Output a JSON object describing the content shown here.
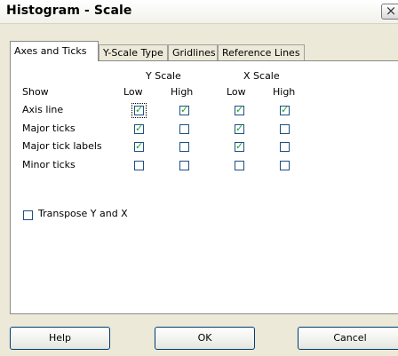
{
  "window": {
    "title": "Histogram - Scale",
    "close_glyph": "×"
  },
  "tabs": [
    {
      "label": "Axes and Ticks",
      "active": true
    },
    {
      "label": "Y-Scale Type",
      "active": false
    },
    {
      "label": "Gridlines",
      "active": false
    },
    {
      "label": "Reference Lines",
      "active": false
    }
  ],
  "headers": {
    "y_scale": "Y Scale",
    "x_scale": "X Scale",
    "show": "Show",
    "low": "Low",
    "high": "High"
  },
  "rows": [
    {
      "label": "Axis line",
      "y_low": true,
      "y_high": true,
      "x_low": true,
      "x_high": true
    },
    {
      "label": "Major ticks",
      "y_low": true,
      "y_high": false,
      "x_low": true,
      "x_high": false
    },
    {
      "label": "Major tick labels",
      "y_low": true,
      "y_high": false,
      "x_low": true,
      "x_high": false
    },
    {
      "label": "Minor ticks",
      "y_low": false,
      "y_high": false,
      "x_low": false,
      "x_high": false
    }
  ],
  "transpose": {
    "label": "Transpose Y and X",
    "checked": false
  },
  "buttons": {
    "help": "Help",
    "ok": "OK",
    "cancel": "Cancel"
  },
  "colors": {
    "check_mark": "#21a121",
    "checkbox_border": "#1c5180"
  },
  "icons": {
    "check": "✓",
    "close": "close-icon"
  }
}
